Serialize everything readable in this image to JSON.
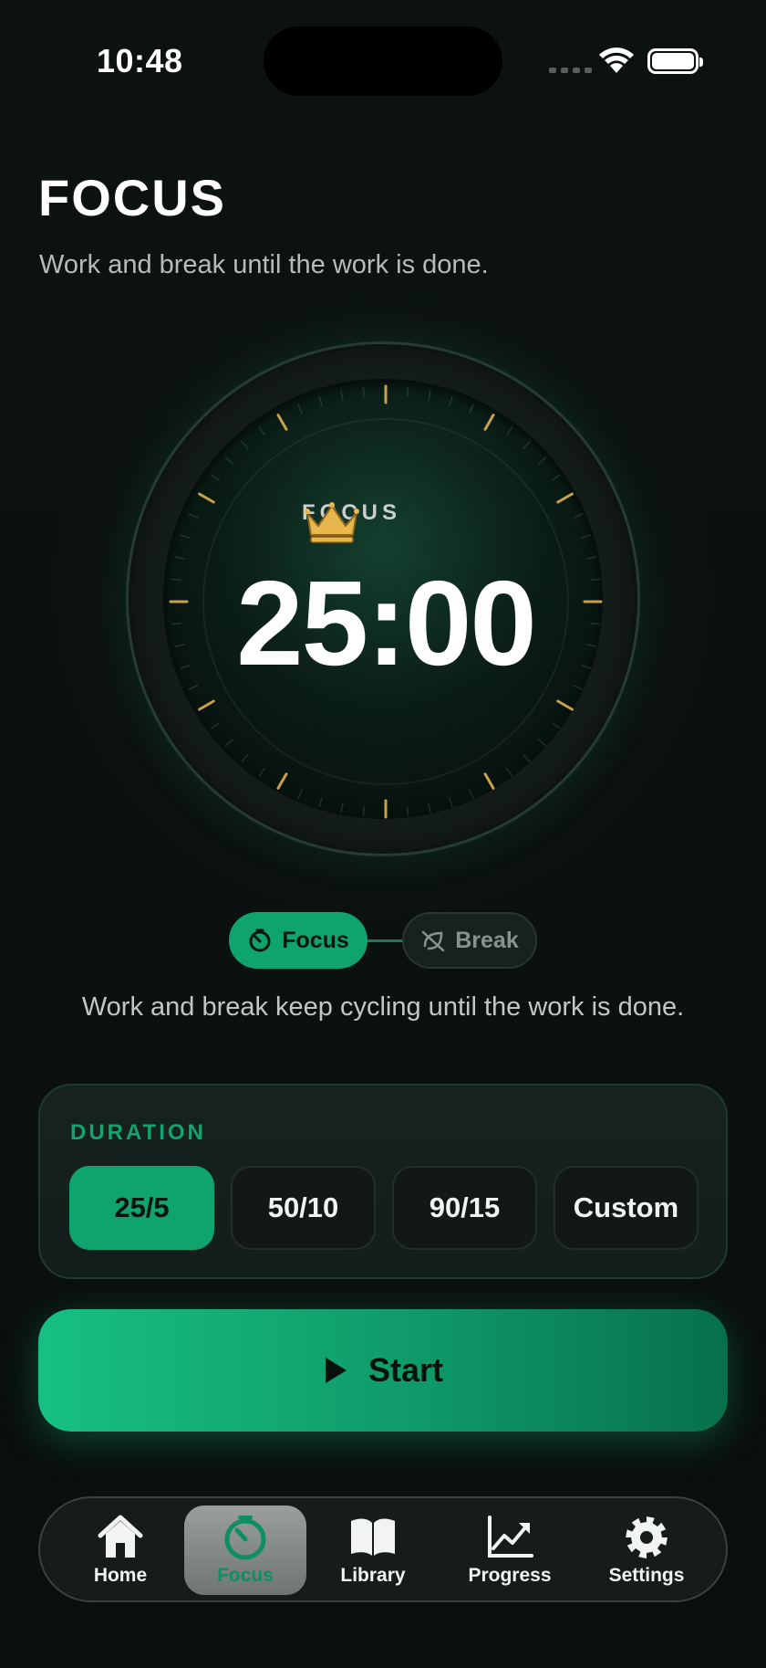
{
  "status_bar": {
    "time": "10:48"
  },
  "header": {
    "title": "FOCUS",
    "subtitle": "Work and break until the work is done."
  },
  "timer": {
    "mode_label": "FOCUS",
    "time": "25:00",
    "mode_icon": "crown-icon"
  },
  "mode_toggle": {
    "focus_label": "Focus",
    "break_label": "Break",
    "active": "Focus"
  },
  "cycle_text": "Work and break keep cycling until the work is done.",
  "duration": {
    "label": "DURATION",
    "options": [
      "25/5",
      "50/10",
      "90/15",
      "Custom"
    ],
    "selected": "25/5"
  },
  "start_button": {
    "label": "Start"
  },
  "tab_bar": {
    "tabs": [
      {
        "label": "Home",
        "icon": "home-icon"
      },
      {
        "label": "Focus",
        "icon": "timer-icon"
      },
      {
        "label": "Library",
        "icon": "book-icon"
      },
      {
        "label": "Progress",
        "icon": "chart-icon"
      },
      {
        "label": "Settings",
        "icon": "gear-icon"
      }
    ],
    "active": "Focus"
  },
  "colors": {
    "accent": "#0fa36e",
    "background": "#0b1110",
    "tick_gold": "#c9a14a"
  }
}
